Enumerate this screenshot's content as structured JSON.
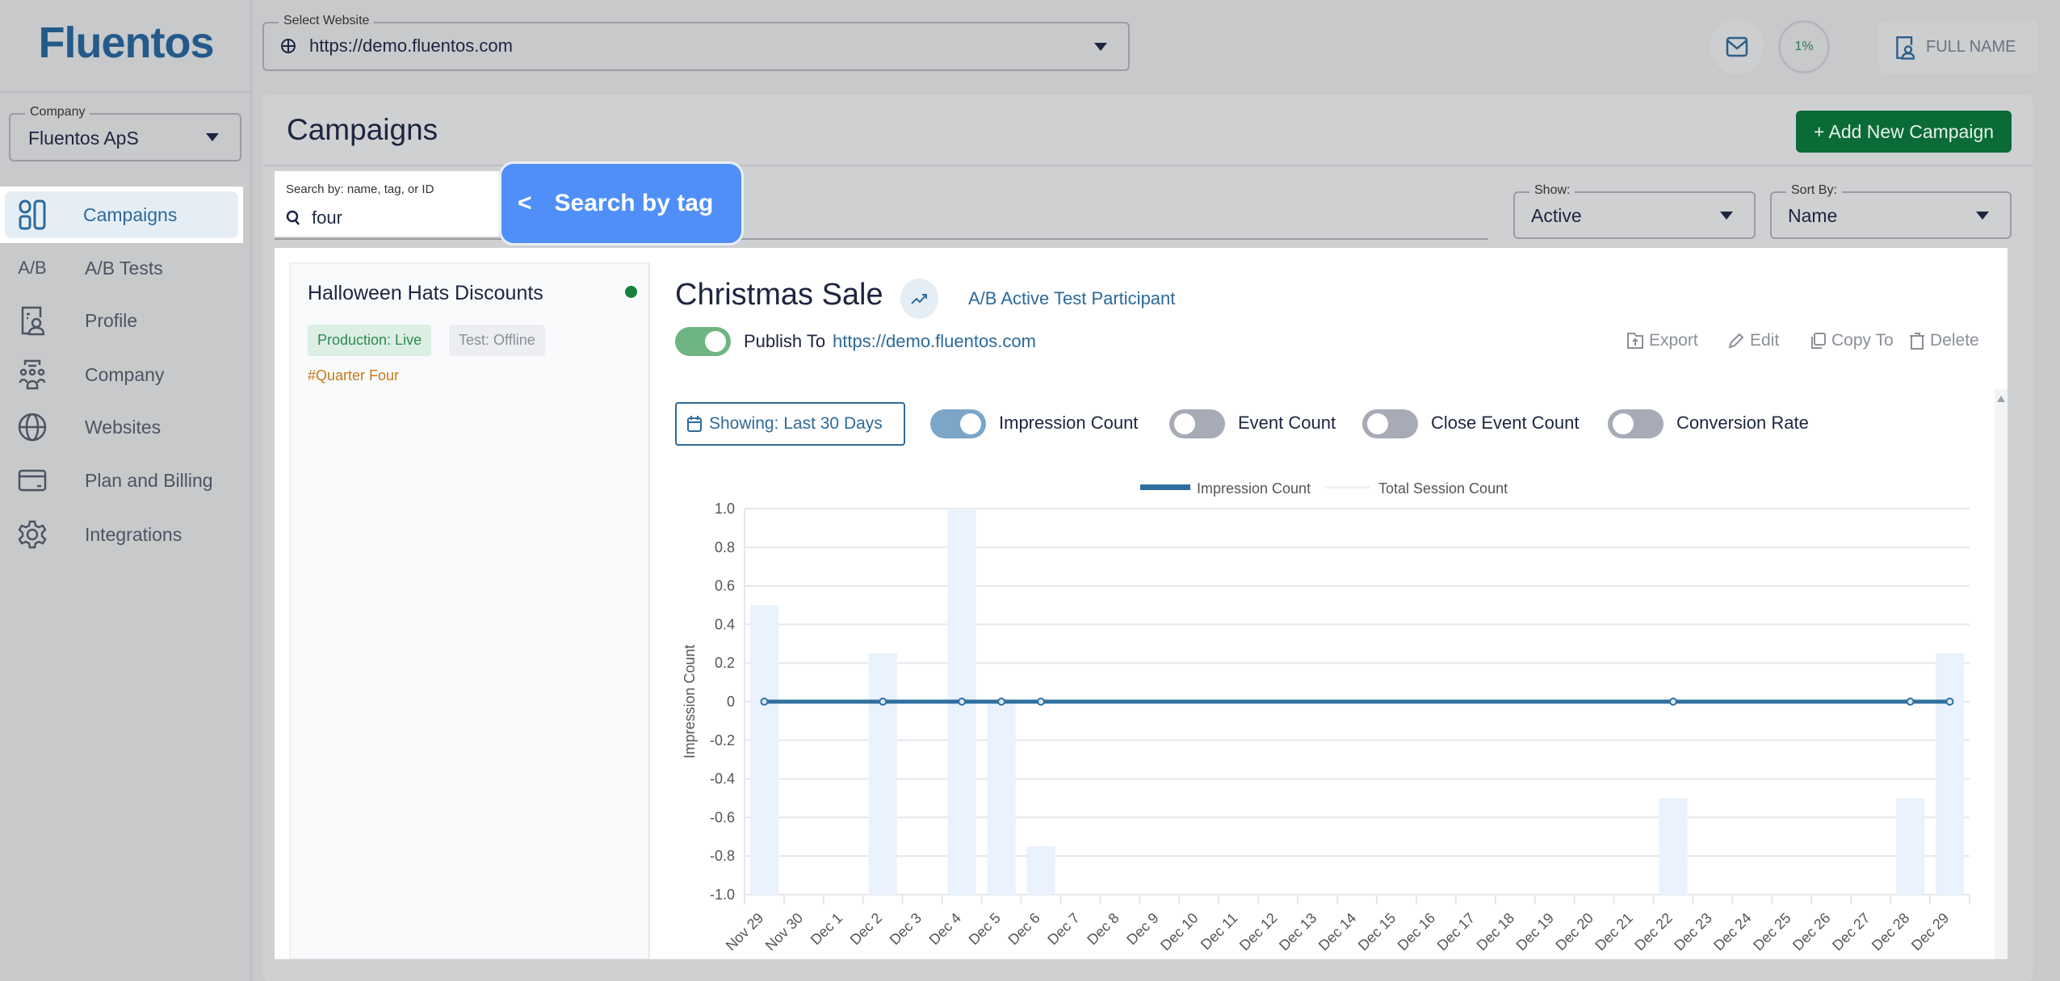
{
  "app": {
    "logo": "Fluentos"
  },
  "topbar": {
    "website_label": "Select Website",
    "website_value": "https://demo.fluentos.com",
    "progress": "1%",
    "progress_value": 1,
    "user": "FULL NAME"
  },
  "sidebar": {
    "company_label": "Company",
    "company_value": "Fluentos ApS",
    "items": [
      {
        "label": "Campaigns",
        "icon": "campaigns-icon"
      },
      {
        "label": "A/B Tests",
        "icon": "ab-icon"
      },
      {
        "label": "Profile",
        "icon": "profile-icon"
      },
      {
        "label": "Company",
        "icon": "company-icon"
      },
      {
        "label": "Websites",
        "icon": "globe-icon"
      },
      {
        "label": "Plan and Billing",
        "icon": "card-icon"
      },
      {
        "label": "Integrations",
        "icon": "gear-icon"
      }
    ],
    "ab_glyph": "A/B"
  },
  "page": {
    "title": "Campaigns",
    "add_button": "+ Add New Campaign",
    "search_label": "Search by: name, tag, or ID",
    "search_value": "four",
    "tooltip": "Search by tag",
    "tooltip_arrow": "<",
    "show_label": "Show:",
    "show_value": "Active",
    "sort_label": "Sort By:",
    "sort_value": "Name"
  },
  "campaign_list": [
    {
      "name": "Halloween Hats Discounts",
      "status_color": "#16803c",
      "production": "Production: Live",
      "test": "Test: Offline",
      "tag": "#Quarter Four"
    }
  ],
  "detail": {
    "title": "Christmas Sale",
    "ab_badge": "A/B Active Test Participant",
    "publish_label": "Publish To",
    "publish_url": "https://demo.fluentos.com",
    "publish_on": true,
    "actions": [
      "Export",
      "Edit",
      "Copy To",
      "Delete"
    ],
    "date_range": "Showing: Last 30 Days",
    "toggles": [
      {
        "label": "Impression Count",
        "on": true
      },
      {
        "label": "Event Count",
        "on": false
      },
      {
        "label": "Close Event Count",
        "on": false
      },
      {
        "label": "Conversion Rate",
        "on": false
      }
    ]
  },
  "chart_data": {
    "type": "bar+line",
    "ylabel": "Impression Count",
    "ylim": [
      -1,
      1
    ],
    "yticks": [
      "1.0",
      "0.8",
      "0.6",
      "0.4",
      "0.2",
      "0",
      "-0.2",
      "-0.4",
      "-0.6",
      "-0.8",
      "-1.0"
    ],
    "grid": true,
    "legend": "top",
    "categories": [
      "Nov 29",
      "Nov 30",
      "Dec 1",
      "Dec 2",
      "Dec 3",
      "Dec 4",
      "Dec 5",
      "Dec 6",
      "Dec 7",
      "Dec 8",
      "Dec 9",
      "Dec 10",
      "Dec 11",
      "Dec 12",
      "Dec 13",
      "Dec 14",
      "Dec 15",
      "Dec 16",
      "Dec 17",
      "Dec 18",
      "Dec 19",
      "Dec 20",
      "Dec 21",
      "Dec 22",
      "Dec 23",
      "Dec 24",
      "Dec 25",
      "Dec 26",
      "Dec 27",
      "Dec 28",
      "Dec 29"
    ],
    "series": [
      {
        "name": "Impression Count",
        "type": "line",
        "color": "#2f6f9f",
        "values": [
          0,
          0,
          0,
          0,
          0,
          0,
          0,
          0,
          0,
          0,
          0,
          0,
          0,
          0,
          0,
          0,
          0,
          0,
          0,
          0,
          0,
          0,
          0,
          0,
          0,
          0,
          0,
          0,
          0,
          0,
          0
        ],
        "markers": [
          "Nov 29",
          "Dec 2",
          "Dec 4",
          "Dec 5",
          "Dec 6",
          "Dec 22",
          "Dec 28",
          "Dec 29"
        ]
      },
      {
        "name": "Total Session Count",
        "type": "bar",
        "color": "#eaf2fd",
        "values": {
          "Nov 29": 0.5,
          "Dec 2": 0.25,
          "Dec 4": 1.0,
          "Dec 5": 0,
          "Dec 6": -0.75,
          "Dec 22": -0.5,
          "Dec 28": -0.5,
          "Dec 29": 0.25
        }
      }
    ]
  }
}
